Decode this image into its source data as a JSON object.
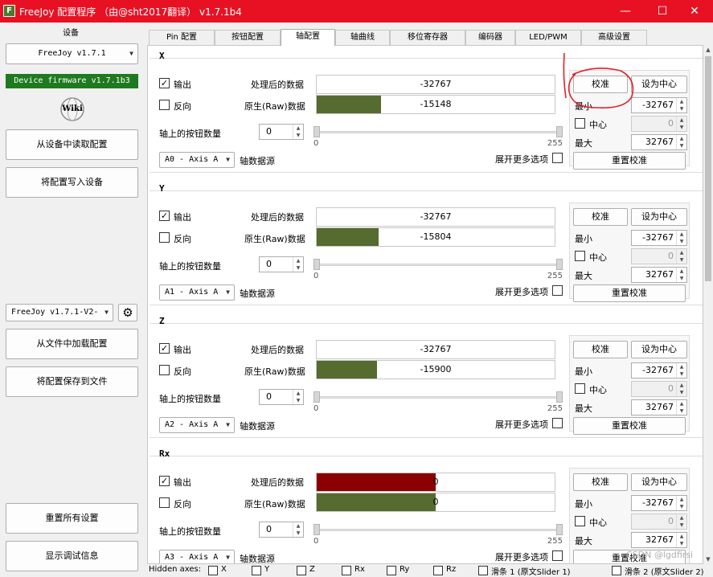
{
  "window": {
    "title": "FreeJoy 配置程序 （由@sht2017翻译） v1.7.1b4",
    "app_icon": "F",
    "minimize": "—",
    "maximize": "☐",
    "close": "✕"
  },
  "left": {
    "device_section": "设备",
    "device_select": "FreeJoy v1.7.1",
    "firmware_badge": "Device firmware v1.7.1b3",
    "firmware_badge_color": "#1f7a1f",
    "wiki_label": "Wiki",
    "read_from_device": "从设备中读取配置",
    "write_to_device": "将配置写入设备",
    "config_select": "FreeJoy v1.7.1-V2-",
    "load_from_file": "从文件中加载配置",
    "save_to_file": "将配置保存到文件",
    "reset_all": "重置所有设置",
    "show_debug": "显示调试信息"
  },
  "tabs": [
    "Pin 配置",
    "按钮配置",
    "轴配置",
    "轴曲线",
    "移位寄存器",
    "编码器",
    "LED/PWM",
    "高级设置"
  ],
  "active_tab": 2,
  "labels": {
    "output": "输出",
    "invert": "反向",
    "processed": "处理后的数据",
    "raw": "原生(Raw)数据",
    "buttons_on_axis": "轴上的按钮数量",
    "data_source": "轴数据源",
    "expand_more": "展开更多选项",
    "calibrate": "校准",
    "set_center": "设为中心",
    "min": "最小",
    "center": "中心",
    "max": "最大",
    "reset_calibration": "重置校准",
    "slider_min": "0",
    "slider_max": "255"
  },
  "axes": [
    {
      "name": "X",
      "output": true,
      "invert": false,
      "processed": "-32767",
      "processed_ratio": 0.0,
      "raw": "-15148",
      "raw_ratio": 0.27,
      "buttons": "0",
      "source": "A0 - Axis A",
      "min": "-32767",
      "center": "0",
      "max": "32767",
      "raw_color": "#556b2f",
      "proc_color": "#556b2f"
    },
    {
      "name": "Y",
      "output": true,
      "invert": false,
      "processed": "-32767",
      "processed_ratio": 0.0,
      "raw": "-15804",
      "raw_ratio": 0.26,
      "buttons": "0",
      "source": "A1 - Axis A",
      "min": "-32767",
      "center": "0",
      "max": "32767",
      "raw_color": "#556b2f",
      "proc_color": "#556b2f"
    },
    {
      "name": "Z",
      "output": true,
      "invert": false,
      "processed": "-32767",
      "processed_ratio": 0.0,
      "raw": "-15900",
      "raw_ratio": 0.255,
      "buttons": "0",
      "source": "A2 - Axis A",
      "min": "-32767",
      "center": "0",
      "max": "32767",
      "raw_color": "#556b2f",
      "proc_color": "#556b2f"
    },
    {
      "name": "Rx",
      "output": true,
      "invert": false,
      "processed": "0",
      "processed_ratio": 0.5,
      "raw": "0",
      "raw_ratio": 0.5,
      "buttons": "0",
      "source": "A3 - Axis A",
      "min": "-32767",
      "center": "0",
      "max": "32767",
      "raw_color": "#556b2f",
      "proc_color": "#8b0000"
    }
  ],
  "bottom": {
    "hidden_axes": "Hidden axes:",
    "items": [
      "X",
      "Y",
      "Z",
      "Rx",
      "Ry",
      "Rz",
      "滑条 1 (原文Slider 1)",
      "滑条 2 (原文Slider 2)"
    ],
    "watermark": "CSDN @lgdfirsi"
  }
}
